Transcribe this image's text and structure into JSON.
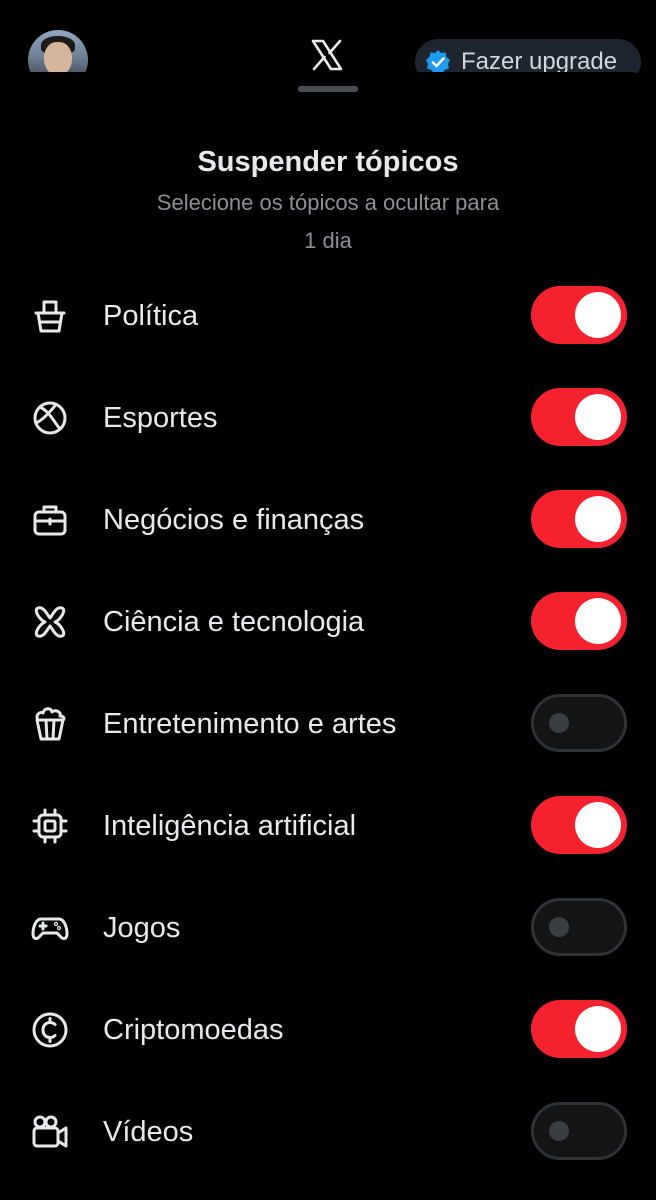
{
  "header": {
    "logo": "x-logo-icon",
    "upgrade_label": "Fazer upgrade",
    "verified_badge_color": "#1d9bf0"
  },
  "sheet": {
    "title": "Suspender tópicos",
    "subtitle": "Selecione os tópicos a ocultar para 1 dia"
  },
  "colors": {
    "toggle_on": "#f4212e",
    "toggle_off": "#141414",
    "background": "#000000",
    "text": "#e7e9ea"
  },
  "topics": [
    {
      "label": "Política",
      "icon": "ballot-box-icon",
      "enabled": true
    },
    {
      "label": "Esportes",
      "icon": "ball-icon",
      "enabled": true
    },
    {
      "label": "Negócios e finanças",
      "icon": "briefcase-icon",
      "enabled": true
    },
    {
      "label": "Ciência e tecnologia",
      "icon": "atom-icon",
      "enabled": true
    },
    {
      "label": "Entretenimento e artes",
      "icon": "popcorn-icon",
      "enabled": false
    },
    {
      "label": "Inteligência artificial",
      "icon": "chip-icon",
      "enabled": true
    },
    {
      "label": "Jogos",
      "icon": "gamepad-icon",
      "enabled": false
    },
    {
      "label": "Criptomoedas",
      "icon": "coin-icon",
      "enabled": true
    },
    {
      "label": "Vídeos",
      "icon": "video-camera-icon",
      "enabled": false
    }
  ]
}
